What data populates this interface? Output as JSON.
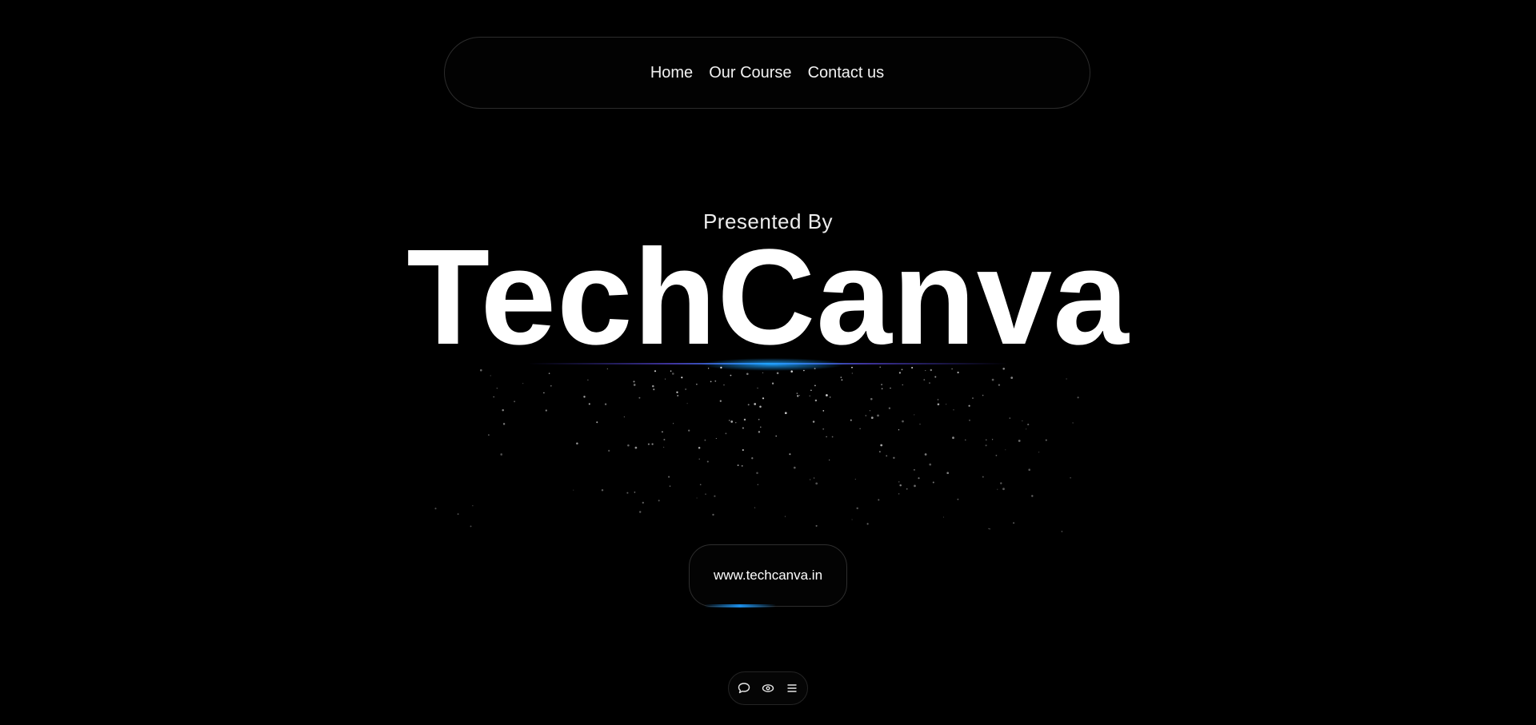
{
  "nav": {
    "links": [
      {
        "label": "Home"
      },
      {
        "label": "Our Course"
      },
      {
        "label": "Contact us"
      }
    ]
  },
  "hero": {
    "presented_by": "Presented By",
    "brand": "TechCanva",
    "url_label": "www.techcanva.in"
  },
  "toolbar": {
    "icons": [
      "chat-bubble-icon",
      "eye-icon",
      "menu-icon"
    ]
  },
  "colors": {
    "background": "#000000",
    "text": "#ffffff",
    "accent_glow": "#1b8ee8",
    "border": "#2c2c2c"
  }
}
